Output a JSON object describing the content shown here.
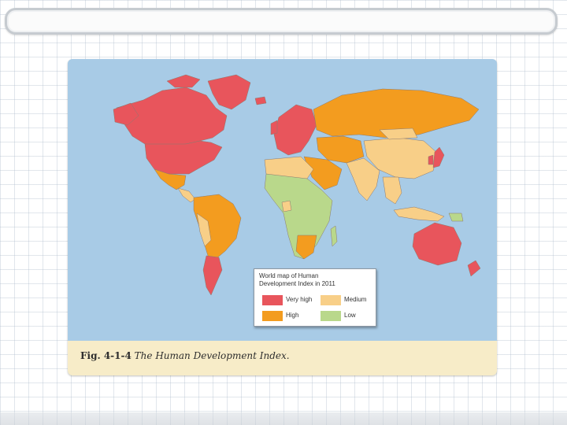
{
  "figure": {
    "caption_label": "Fig. 4-1-4",
    "caption_text": "The Human Development Index."
  },
  "legend": {
    "title": "World map of Human Development Index in 2011",
    "items": [
      {
        "label": "Very high",
        "color": "#e8555c"
      },
      {
        "label": "Medium",
        "color": "#f8cf88"
      },
      {
        "label": "High",
        "color": "#f39c1f"
      },
      {
        "label": "Low",
        "color": "#b9d88b"
      }
    ]
  },
  "colors": {
    "ocean": "#a8cbe6",
    "very_high": "#e8555c",
    "high": "#f39c1f",
    "medium": "#f8cf88",
    "low": "#b9d88b",
    "caption_band": "#f7ecc8"
  }
}
